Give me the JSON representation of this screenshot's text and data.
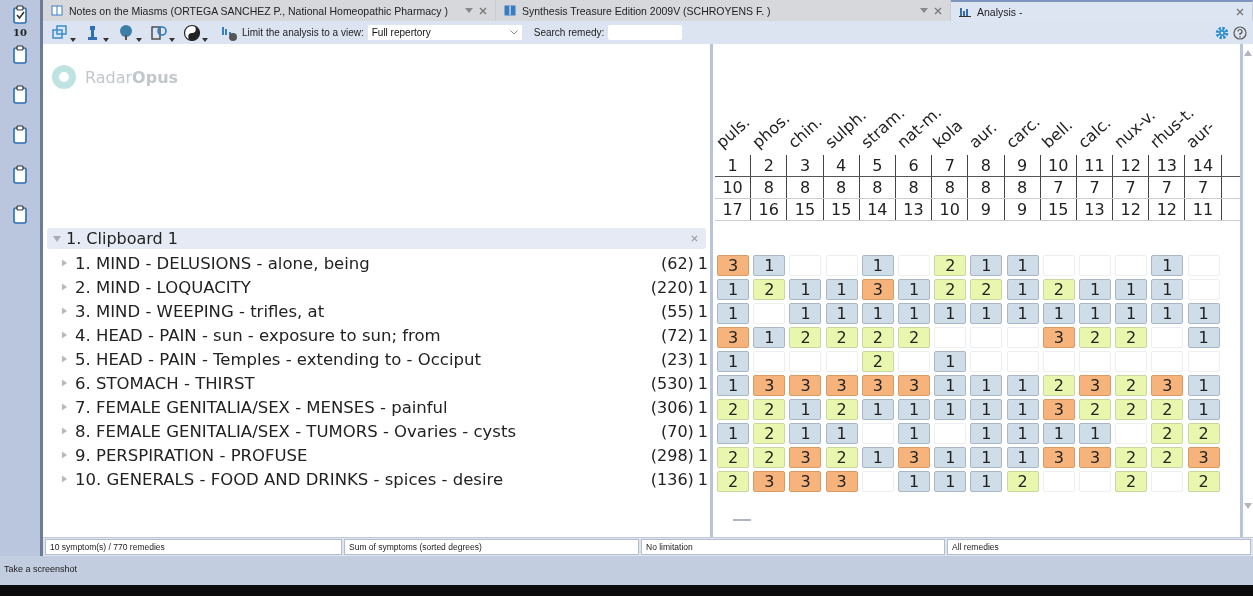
{
  "sidebar": {
    "items": [
      {
        "kind": "checked",
        "count": "10"
      },
      {
        "kind": "plain"
      },
      {
        "kind": "plain"
      },
      {
        "kind": "plain"
      },
      {
        "kind": "plain"
      },
      {
        "kind": "plain"
      }
    ]
  },
  "tabs": [
    {
      "label": "Notes on the Miasms (ORTEGA SANCHEZ P., National Homeopathic Pharmacy )",
      "selected": false,
      "kind": "book"
    },
    {
      "label": "Synthesis Treasure Edition 2009V (SCHROYENS F. )",
      "selected": false,
      "kind": "book"
    },
    {
      "label": "Analysis -",
      "selected": true,
      "kind": "analysis"
    }
  ],
  "toolbar": {
    "view_label": "Limit the analysis to a view:",
    "view_value": "Full repertory",
    "search_label": "Search remedy:"
  },
  "logo": {
    "word_light": "Radar",
    "word_bold": "Opus"
  },
  "clipboard": {
    "title": "1. Clipboard 1",
    "expanded": true
  },
  "columns": [
    {
      "remedy": "puls.",
      "number": "1",
      "symptoms": "10",
      "degrees": "17"
    },
    {
      "remedy": "phos.",
      "number": "2",
      "symptoms": "8",
      "degrees": "16"
    },
    {
      "remedy": "chin.",
      "number": "3",
      "symptoms": "8",
      "degrees": "15"
    },
    {
      "remedy": "sulph.",
      "number": "4",
      "symptoms": "8",
      "degrees": "15"
    },
    {
      "remedy": "stram.",
      "number": "5",
      "symptoms": "8",
      "degrees": "14"
    },
    {
      "remedy": "nat-m.",
      "number": "6",
      "symptoms": "8",
      "degrees": "13"
    },
    {
      "remedy": "kola",
      "number": "7",
      "symptoms": "8",
      "degrees": "10"
    },
    {
      "remedy": "aur.",
      "number": "8",
      "symptoms": "8",
      "degrees": "9"
    },
    {
      "remedy": "carc.",
      "number": "9",
      "symptoms": "8",
      "degrees": "9"
    },
    {
      "remedy": "bell.",
      "number": "10",
      "symptoms": "7",
      "degrees": "15"
    },
    {
      "remedy": "calc.",
      "number": "11",
      "symptoms": "7",
      "degrees": "13"
    },
    {
      "remedy": "nux-v.",
      "number": "12",
      "symptoms": "7",
      "degrees": "12"
    },
    {
      "remedy": "rhus-t.",
      "number": "13",
      "symptoms": "7",
      "degrees": "12"
    },
    {
      "remedy": "aur-",
      "number": "14",
      "symptoms": "7",
      "degrees": "11"
    }
  ],
  "symptoms": [
    {
      "text": "1. MIND - DELUSIONS - alone, being",
      "count": "(62)",
      "weight": "1",
      "expanded": false,
      "cells": [
        {
          "filled": true,
          "grade": "3"
        },
        {
          "filled": true,
          "grade": "1"
        },
        {
          "filled": false
        },
        {
          "filled": false
        },
        {
          "filled": true,
          "grade": "1"
        },
        {
          "filled": false
        },
        {
          "filled": true,
          "grade": "2"
        },
        {
          "filled": true,
          "grade": "1"
        },
        {
          "filled": true,
          "grade": "1"
        },
        {
          "filled": false
        },
        {
          "filled": false
        },
        {
          "filled": false
        },
        {
          "filled": true,
          "grade": "1"
        },
        {
          "filled": false
        }
      ]
    },
    {
      "text": "2. MIND - LOQUACITY",
      "count": "(220)",
      "weight": "1",
      "expanded": false,
      "cells": [
        {
          "filled": true,
          "grade": "1"
        },
        {
          "filled": true,
          "grade": "2"
        },
        {
          "filled": true,
          "grade": "1"
        },
        {
          "filled": true,
          "grade": "1"
        },
        {
          "filled": true,
          "grade": "3"
        },
        {
          "filled": true,
          "grade": "1"
        },
        {
          "filled": true,
          "grade": "2"
        },
        {
          "filled": true,
          "grade": "2"
        },
        {
          "filled": true,
          "grade": "1"
        },
        {
          "filled": true,
          "grade": "2"
        },
        {
          "filled": true,
          "grade": "1"
        },
        {
          "filled": true,
          "grade": "1"
        },
        {
          "filled": true,
          "grade": "1"
        },
        {
          "filled": false
        }
      ]
    },
    {
      "text": "3. MIND - WEEPING - trifles, at",
      "count": "(55)",
      "weight": "1",
      "expanded": false,
      "cells": [
        {
          "filled": true,
          "grade": "1"
        },
        {
          "filled": false
        },
        {
          "filled": true,
          "grade": "1"
        },
        {
          "filled": true,
          "grade": "1"
        },
        {
          "filled": true,
          "grade": "1"
        },
        {
          "filled": true,
          "grade": "1"
        },
        {
          "filled": true,
          "grade": "1"
        },
        {
          "filled": true,
          "grade": "1"
        },
        {
          "filled": true,
          "grade": "1"
        },
        {
          "filled": true,
          "grade": "1"
        },
        {
          "filled": true,
          "grade": "1"
        },
        {
          "filled": true,
          "grade": "1"
        },
        {
          "filled": true,
          "grade": "1"
        },
        {
          "filled": true,
          "grade": "1"
        }
      ]
    },
    {
      "text": "4. HEAD - PAIN - sun - exposure to sun; from",
      "count": "(72)",
      "weight": "1",
      "expanded": false,
      "cells": [
        {
          "filled": true,
          "grade": "3"
        },
        {
          "filled": true,
          "grade": "1"
        },
        {
          "filled": true,
          "grade": "2"
        },
        {
          "filled": true,
          "grade": "2"
        },
        {
          "filled": true,
          "grade": "2"
        },
        {
          "filled": true,
          "grade": "2"
        },
        {
          "filled": false
        },
        {
          "filled": false
        },
        {
          "filled": false
        },
        {
          "filled": true,
          "grade": "3"
        },
        {
          "filled": true,
          "grade": "2"
        },
        {
          "filled": true,
          "grade": "2"
        },
        {
          "filled": false
        },
        {
          "filled": true,
          "grade": "1"
        }
      ]
    },
    {
      "text": "5. HEAD - PAIN - Temples - extending to - Occiput",
      "count": "(23)",
      "weight": "1",
      "expanded": false,
      "cells": [
        {
          "filled": true,
          "grade": "1"
        },
        {
          "filled": false
        },
        {
          "filled": false
        },
        {
          "filled": false
        },
        {
          "filled": true,
          "grade": "2"
        },
        {
          "filled": false
        },
        {
          "filled": true,
          "grade": "1"
        },
        {
          "filled": false
        },
        {
          "filled": false
        },
        {
          "filled": false
        },
        {
          "filled": false
        },
        {
          "filled": false
        },
        {
          "filled": false
        },
        {
          "filled": false
        }
      ]
    },
    {
      "text": "6. STOMACH - THIRST",
      "count": "(530)",
      "weight": "1",
      "expanded": false,
      "cells": [
        {
          "filled": true,
          "grade": "1"
        },
        {
          "filled": true,
          "grade": "3"
        },
        {
          "filled": true,
          "grade": "3"
        },
        {
          "filled": true,
          "grade": "3"
        },
        {
          "filled": true,
          "grade": "3"
        },
        {
          "filled": true,
          "grade": "3"
        },
        {
          "filled": true,
          "grade": "1"
        },
        {
          "filled": true,
          "grade": "1"
        },
        {
          "filled": true,
          "grade": "1"
        },
        {
          "filled": true,
          "grade": "2"
        },
        {
          "filled": true,
          "grade": "3"
        },
        {
          "filled": true,
          "grade": "2"
        },
        {
          "filled": true,
          "grade": "3"
        },
        {
          "filled": true,
          "grade": "1"
        }
      ]
    },
    {
      "text": "7. FEMALE GENITALIA/SEX - MENSES - painful",
      "count": "(306)",
      "weight": "1",
      "expanded": false,
      "cells": [
        {
          "filled": true,
          "grade": "2"
        },
        {
          "filled": true,
          "grade": "2"
        },
        {
          "filled": true,
          "grade": "1"
        },
        {
          "filled": true,
          "grade": "2"
        },
        {
          "filled": true,
          "grade": "1"
        },
        {
          "filled": true,
          "grade": "1"
        },
        {
          "filled": true,
          "grade": "1"
        },
        {
          "filled": true,
          "grade": "1"
        },
        {
          "filled": true,
          "grade": "1"
        },
        {
          "filled": true,
          "grade": "3"
        },
        {
          "filled": true,
          "grade": "2"
        },
        {
          "filled": true,
          "grade": "2"
        },
        {
          "filled": true,
          "grade": "2"
        },
        {
          "filled": true,
          "grade": "1"
        }
      ]
    },
    {
      "text": "8. FEMALE GENITALIA/SEX - TUMORS - Ovaries - cysts",
      "count": "(70)",
      "weight": "1",
      "expanded": false,
      "cells": [
        {
          "filled": true,
          "grade": "1"
        },
        {
          "filled": true,
          "grade": "2"
        },
        {
          "filled": true,
          "grade": "1"
        },
        {
          "filled": true,
          "grade": "1"
        },
        {
          "filled": false
        },
        {
          "filled": true,
          "grade": "1"
        },
        {
          "filled": false
        },
        {
          "filled": true,
          "grade": "1"
        },
        {
          "filled": true,
          "grade": "1"
        },
        {
          "filled": true,
          "grade": "1"
        },
        {
          "filled": true,
          "grade": "1"
        },
        {
          "filled": false
        },
        {
          "filled": true,
          "grade": "2"
        },
        {
          "filled": true,
          "grade": "2"
        }
      ]
    },
    {
      "text": "9. PERSPIRATION - PROFUSE",
      "count": "(298)",
      "weight": "1",
      "expanded": false,
      "cells": [
        {
          "filled": true,
          "grade": "2"
        },
        {
          "filled": true,
          "grade": "2"
        },
        {
          "filled": true,
          "grade": "3"
        },
        {
          "filled": true,
          "grade": "2"
        },
        {
          "filled": true,
          "grade": "1"
        },
        {
          "filled": true,
          "grade": "3"
        },
        {
          "filled": true,
          "grade": "1"
        },
        {
          "filled": true,
          "grade": "1"
        },
        {
          "filled": true,
          "grade": "1"
        },
        {
          "filled": true,
          "grade": "3"
        },
        {
          "filled": true,
          "grade": "3"
        },
        {
          "filled": true,
          "grade": "2"
        },
        {
          "filled": true,
          "grade": "2"
        },
        {
          "filled": true,
          "grade": "3"
        }
      ]
    },
    {
      "text": "10. GENERALS - FOOD AND DRINKS - spices - desire",
      "count": "(136)",
      "weight": "1",
      "expanded": false,
      "cells": [
        {
          "filled": true,
          "grade": "2"
        },
        {
          "filled": true,
          "grade": "3"
        },
        {
          "filled": true,
          "grade": "3"
        },
        {
          "filled": true,
          "grade": "3"
        },
        {
          "filled": false
        },
        {
          "filled": true,
          "grade": "1"
        },
        {
          "filled": true,
          "grade": "1"
        },
        {
          "filled": true,
          "grade": "1"
        },
        {
          "filled": true,
          "grade": "2"
        },
        {
          "filled": false
        },
        {
          "filled": false
        },
        {
          "filled": true,
          "grade": "2"
        },
        {
          "filled": false
        },
        {
          "filled": true,
          "grade": "2"
        }
      ]
    }
  ],
  "status_bar": [
    "10 symptom(s) / 770 remedies",
    "Sum of symptoms (sorted degrees)",
    "No limitation",
    "All remedies"
  ],
  "hint": "Take a screenshot"
}
